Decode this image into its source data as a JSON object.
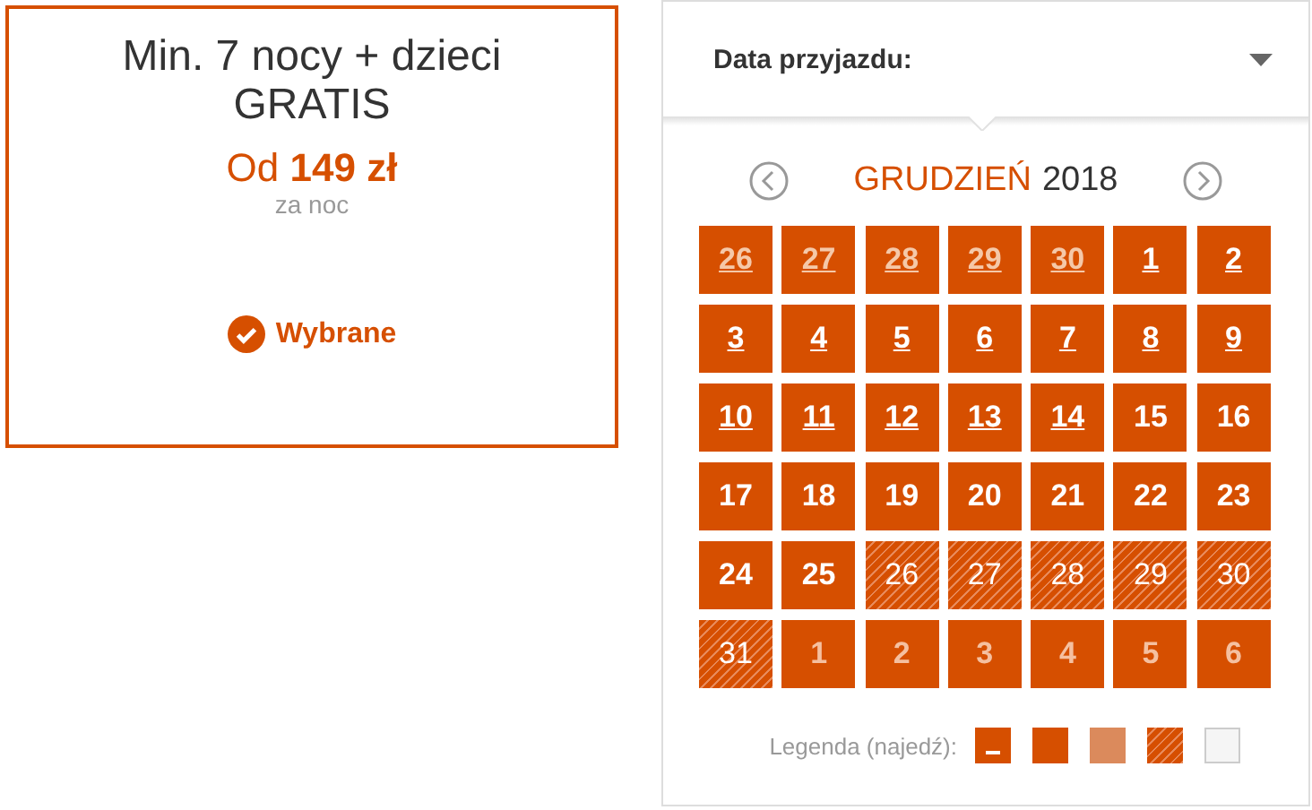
{
  "offer": {
    "title": "Min. 7 nocy + dzieci GRATIS",
    "price": "Od **149 zł**",
    "price_note": "za noc",
    "status": "Wybrane",
    "selected": true
  },
  "date_picker": {
    "label": "Data przyjazdu:",
    "expanded": true,
    "month": "GRUDZIEŃ",
    "year": "2018",
    "days": [
      {
        "day": "26",
        "kind": "other-link"
      },
      {
        "day": "27",
        "kind": "other-link"
      },
      {
        "day": "28",
        "kind": "other-link"
      },
      {
        "day": "29",
        "kind": "other-link"
      },
      {
        "day": "30",
        "kind": "other-link"
      },
      {
        "day": "1",
        "kind": "link"
      },
      {
        "day": "2",
        "kind": "link"
      },
      {
        "day": "3",
        "kind": "link"
      },
      {
        "day": "4",
        "kind": "link"
      },
      {
        "day": "5",
        "kind": "link"
      },
      {
        "day": "6",
        "kind": "link"
      },
      {
        "day": "7",
        "kind": "link"
      },
      {
        "day": "8",
        "kind": "link"
      },
      {
        "day": "9",
        "kind": "link"
      },
      {
        "day": "10",
        "kind": "link"
      },
      {
        "day": "11",
        "kind": "link"
      },
      {
        "day": "12",
        "kind": "link"
      },
      {
        "day": "13",
        "kind": "link"
      },
      {
        "day": "14",
        "kind": "link"
      },
      {
        "day": "15",
        "kind": "plain"
      },
      {
        "day": "16",
        "kind": "plain"
      },
      {
        "day": "17",
        "kind": "plain"
      },
      {
        "day": "18",
        "kind": "plain"
      },
      {
        "day": "19",
        "kind": "plain"
      },
      {
        "day": "20",
        "kind": "plain"
      },
      {
        "day": "21",
        "kind": "plain"
      },
      {
        "day": "22",
        "kind": "plain"
      },
      {
        "day": "23",
        "kind": "plain"
      },
      {
        "day": "24",
        "kind": "plain"
      },
      {
        "day": "25",
        "kind": "plain"
      },
      {
        "day": "26",
        "kind": "hatched"
      },
      {
        "day": "27",
        "kind": "hatched"
      },
      {
        "day": "28",
        "kind": "hatched"
      },
      {
        "day": "29",
        "kind": "hatched"
      },
      {
        "day": "30",
        "kind": "hatched"
      },
      {
        "day": "31",
        "kind": "hatched"
      },
      {
        "day": "1",
        "kind": "other"
      },
      {
        "day": "2",
        "kind": "other"
      },
      {
        "day": "3",
        "kind": "other"
      },
      {
        "day": "4",
        "kind": "other"
      },
      {
        "day": "5",
        "kind": "other"
      },
      {
        "day": "6",
        "kind": "other"
      }
    ],
    "legend": {
      "label": "Legenda (najedź):",
      "items": [
        {
          "kind": "link"
        },
        {
          "kind": "plain"
        },
        {
          "kind": "light"
        },
        {
          "kind": "hatched"
        },
        {
          "kind": "empty"
        }
      ]
    }
  }
}
